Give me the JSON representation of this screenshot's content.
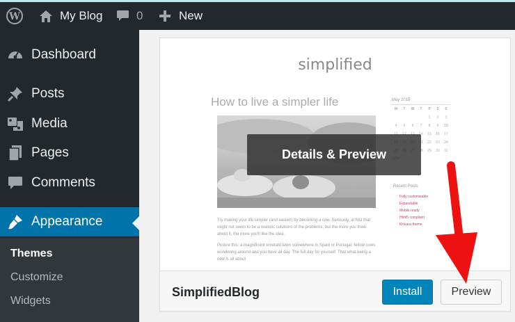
{
  "admin_bar": {
    "site_name": "My Blog",
    "comment_count": "0",
    "new_label": "New"
  },
  "sidebar": {
    "items": [
      {
        "label": "Dashboard",
        "icon": "dashboard-icon"
      },
      {
        "label": "Posts",
        "icon": "pin-icon"
      },
      {
        "label": "Media",
        "icon": "media-icon"
      },
      {
        "label": "Pages",
        "icon": "pages-icon"
      },
      {
        "label": "Comments",
        "icon": "comment-icon"
      },
      {
        "label": "Appearance",
        "icon": "brush-icon",
        "active": true
      }
    ],
    "submenu": [
      {
        "label": "Themes",
        "current": true
      },
      {
        "label": "Customize"
      },
      {
        "label": "Widgets"
      }
    ]
  },
  "theme_card": {
    "screenshot": {
      "site_title": "simplified",
      "post_title": "How to live a simpler life",
      "excerpt_1": "Try making your life simpler (and easier!) by becoming a cow. Seriously, at first that might not seem to be a realistic solutions of the problems, but the more you think about it, the more you'll like the idea.",
      "excerpt_2": "Picture this: a magnificent emerald lawn somewhere in Spain or Portugal, fellow cows wondering around and you have all day. The full day for yourself. That what being a cow is all about",
      "calendar": {
        "caption": "May 2015",
        "headers": [
          "M",
          "T",
          "W",
          "T",
          "F",
          "S",
          "S"
        ],
        "rows": [
          [
            "",
            "",
            "",
            "",
            "1",
            "2",
            "3"
          ],
          [
            "4",
            "5",
            "6",
            "7",
            "8",
            "9",
            "10"
          ],
          [
            "11",
            "12",
            "13",
            "14",
            "15",
            "16",
            "17"
          ],
          [
            "18",
            "19",
            "20",
            "21",
            "22",
            "23",
            "24"
          ],
          [
            "25",
            "26",
            "27",
            "28",
            "29",
            "30",
            "31"
          ]
        ],
        "nav": "« Apr"
      },
      "recent_posts_title": "Recent Posts",
      "recent_posts": [
        "Fully customizable",
        "Expandable",
        "Mobile ready",
        "Html5 compliant",
        "Kickass theme"
      ]
    },
    "overlay_label": "Details & Preview",
    "name": "SimplifiedBlog",
    "install_label": "Install",
    "preview_label": "Preview"
  },
  "colors": {
    "admin_bar_bg": "#23282d",
    "accent_blue": "#0073aa",
    "annotation_arrow": "#ee1111"
  }
}
